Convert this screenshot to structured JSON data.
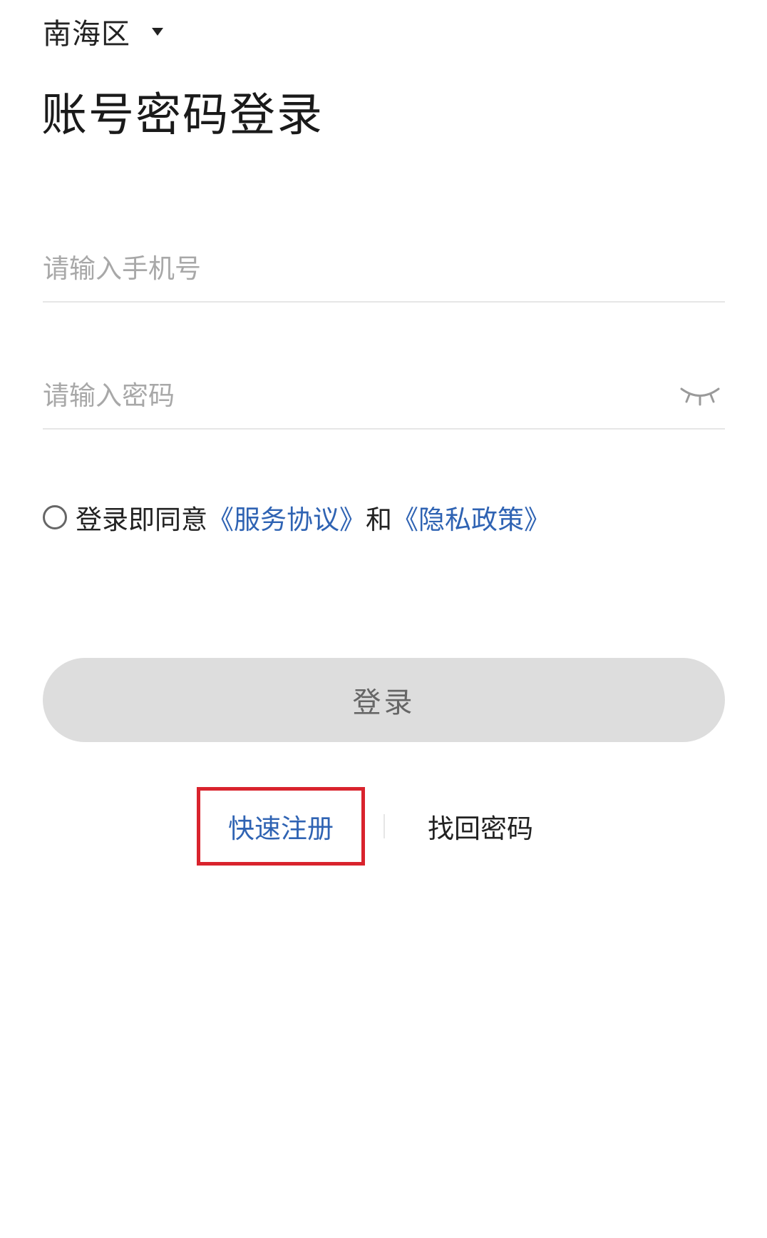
{
  "region": {
    "label": "南海区",
    "icon": "caret-down-icon"
  },
  "title": "账号密码登录",
  "phone_field": {
    "placeholder": "请输入手机号",
    "value": ""
  },
  "password_field": {
    "placeholder": "请输入密码",
    "value": "",
    "toggle_icon": "eye-closed-icon"
  },
  "agreement": {
    "checked": false,
    "prefix": "登录即同意",
    "service_link": "《服务协议》",
    "conjunction": "和",
    "privacy_link": "《隐私政策》"
  },
  "login_button": {
    "label": "登录",
    "enabled": false
  },
  "links": {
    "register": "快速注册",
    "recover": "找回密码"
  },
  "colors": {
    "link": "#2f63b3",
    "highlight_box": "#d9232d",
    "button_disabled_bg": "#dddddd"
  }
}
